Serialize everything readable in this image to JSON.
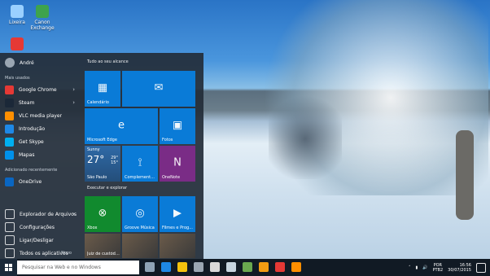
{
  "desktop": {
    "icons": [
      {
        "label": "Lixeira",
        "color": "#9ad0ff"
      },
      {
        "label": "Canon Exchange",
        "color": "#3ea34d"
      },
      {
        "label": "",
        "color": "#e64a19"
      }
    ]
  },
  "start": {
    "user": {
      "name": "André"
    },
    "left": {
      "most_used_title": "Mais usados",
      "most_used": [
        {
          "label": "Google Chrome",
          "icon": "chrome-icon",
          "color": "#e53935"
        },
        {
          "label": "Steam",
          "icon": "steam-icon",
          "color": "#1b2838"
        },
        {
          "label": "VLC media player",
          "icon": "vlc-icon",
          "color": "#ff8f00"
        },
        {
          "label": "Introdução",
          "icon": "get-started-icon",
          "color": "#1e88e5"
        },
        {
          "label": "Get Skype",
          "icon": "skype-icon",
          "color": "#00aff0"
        },
        {
          "label": "Mapas",
          "icon": "maps-icon",
          "color": "#0091ea"
        }
      ],
      "recently_added_title": "Adicionado recentemente",
      "recently_added": [
        {
          "label": "OneDrive",
          "icon": "onedrive-icon",
          "color": "#0a66c2"
        }
      ],
      "bottom": [
        {
          "label": "Explorador de Arquivos",
          "icon": "file-explorer-icon"
        },
        {
          "label": "Configurações",
          "icon": "settings-gear-icon"
        },
        {
          "label": "Ligar/Desligar",
          "icon": "power-icon"
        },
        {
          "label": "Todos os aplicativos",
          "icon": "all-apps-icon"
        }
      ],
      "novo_label": "Novo"
    },
    "right": {
      "group1_title": "Tudo ao seu alcance",
      "group2_title": "Executar e explorar",
      "tiles": [
        {
          "name": "calendar-tile",
          "label": "Calendário",
          "icon": "calendar-icon",
          "glyph": "▦",
          "kind": "blue"
        },
        {
          "name": "mail-tile",
          "label": "",
          "icon": "mail-icon",
          "glyph": "✉",
          "kind": "blue"
        },
        {
          "name": "edge-tile",
          "label": "Microsoft Edge",
          "icon": "edge-icon",
          "glyph": "e",
          "kind": "blue"
        },
        {
          "name": "photos-tile",
          "label": "Fotos",
          "icon": "photos-icon",
          "glyph": "▣",
          "kind": "blue"
        },
        {
          "name": "weather-tile",
          "label": "São Paulo",
          "icon": "weather-icon",
          "glyph": "",
          "kind": "weather",
          "weather": {
            "condition": "Sunny",
            "temp": "27°",
            "hi": "29°",
            "lo": "15°"
          }
        },
        {
          "name": "complements-tile",
          "label": "Complement...",
          "icon": "complement-icon",
          "glyph": "⟟",
          "kind": "blue"
        },
        {
          "name": "onenote-tile",
          "label": "OneNote",
          "icon": "onenote-icon",
          "glyph": "N",
          "kind": "purple"
        },
        {
          "name": "xbox-tile",
          "label": "Xbox",
          "icon": "xbox-icon",
          "glyph": "⊗",
          "kind": "green"
        },
        {
          "name": "groove-tile",
          "label": "Groove Música",
          "icon": "groove-icon",
          "glyph": "◎",
          "kind": "blue"
        },
        {
          "name": "movies-tile",
          "label": "Filmes e Prog...",
          "icon": "movies-icon",
          "glyph": "🎬",
          "kind": "blue"
        },
        {
          "name": "news-tile-1",
          "label": "Juiz de custódia manda soltar...",
          "icon": "news-icon",
          "glyph": "",
          "kind": "news"
        },
        {
          "name": "news-tile-2",
          "label": "",
          "icon": "news-icon",
          "glyph": "",
          "kind": "news"
        },
        {
          "name": "news-tile-3",
          "label": "",
          "icon": "news-icon",
          "glyph": "",
          "kind": "news"
        }
      ]
    }
  },
  "taskbar": {
    "search_placeholder": "Pesquisar na Web e no Windows",
    "pinned": [
      {
        "name": "task-view-button",
        "color": "#8fa3b5"
      },
      {
        "name": "edge-taskbar-button",
        "color": "#1e88e5"
      },
      {
        "name": "explorer-taskbar-button",
        "color": "#f4c20d"
      },
      {
        "name": "store-taskbar-button",
        "color": "#9aa6b2"
      },
      {
        "name": "media-taskbar-button",
        "color": "#d9d9d9"
      },
      {
        "name": "steam-taskbar-button",
        "color": "#c7d5e0"
      },
      {
        "name": "minecraft-taskbar-button",
        "color": "#6aa84f"
      },
      {
        "name": "game-taskbar-button",
        "color": "#f39c12"
      },
      {
        "name": "chrome-taskbar-button",
        "color": "#e53935"
      },
      {
        "name": "vlc-taskbar-button",
        "color": "#ff8f00"
      }
    ],
    "tray": {
      "lang_top": "POR",
      "lang_bottom": "PTB2",
      "time": "16:56",
      "date": "30/07/2015"
    }
  }
}
